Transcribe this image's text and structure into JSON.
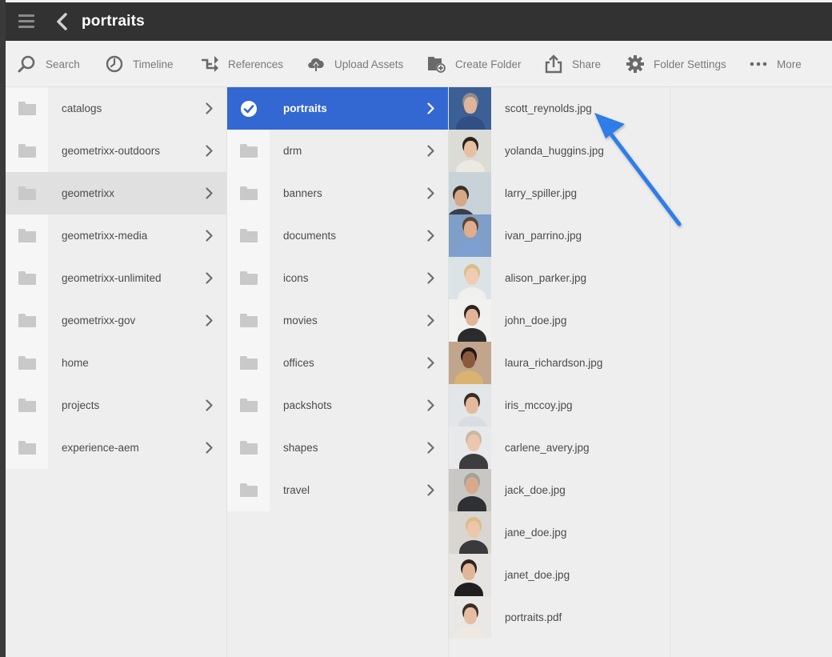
{
  "header": {
    "title": "portraits"
  },
  "toolbar": {
    "search": "Search",
    "timeline": "Timeline",
    "references": "References",
    "upload": "Upload Assets",
    "create_folder": "Create Folder",
    "share": "Share",
    "folder_settings": "Folder Settings",
    "more": "More"
  },
  "column1": [
    {
      "label": "catalogs",
      "has_children": true
    },
    {
      "label": "geometrixx-outdoors",
      "has_children": true
    },
    {
      "label": "geometrixx",
      "has_children": true,
      "state": "hover"
    },
    {
      "label": "geometrixx-media",
      "has_children": true
    },
    {
      "label": "geometrixx-unlimited",
      "has_children": true
    },
    {
      "label": "geometrixx-gov",
      "has_children": true
    },
    {
      "label": "home",
      "has_children": false
    },
    {
      "label": "projects",
      "has_children": true
    },
    {
      "label": "experience-aem",
      "has_children": true
    }
  ],
  "column2": [
    {
      "label": "portraits",
      "has_children": true,
      "state": "selected"
    },
    {
      "label": "drm",
      "has_children": true
    },
    {
      "label": "banners",
      "has_children": true
    },
    {
      "label": "documents",
      "has_children": true
    },
    {
      "label": "icons",
      "has_children": true
    },
    {
      "label": "movies",
      "has_children": true
    },
    {
      "label": "offices",
      "has_children": true
    },
    {
      "label": "packshots",
      "has_children": true
    },
    {
      "label": "shapes",
      "has_children": true
    },
    {
      "label": "travel",
      "has_children": true
    }
  ],
  "column3": [
    {
      "label": "scott_reynolds.jpg"
    },
    {
      "label": "yolanda_huggins.jpg"
    },
    {
      "label": "larry_spiller.jpg"
    },
    {
      "label": "ivan_parrino.jpg"
    },
    {
      "label": "alison_parker.jpg"
    },
    {
      "label": "john_doe.jpg"
    },
    {
      "label": "laura_richardson.jpg"
    },
    {
      "label": "iris_mccoy.jpg"
    },
    {
      "label": "carlene_avery.jpg"
    },
    {
      "label": "jack_doe.jpg"
    },
    {
      "label": "jane_doe.jpg"
    },
    {
      "label": "janet_doe.jpg"
    },
    {
      "label": "portraits.pdf"
    }
  ],
  "colors": {
    "topbar": "#323232",
    "selected": "#3367d1",
    "arrow": "#2f7de8"
  }
}
